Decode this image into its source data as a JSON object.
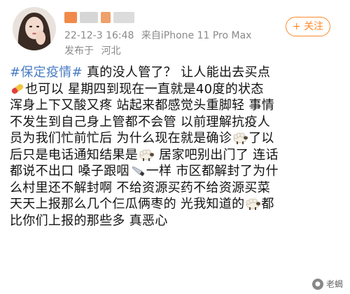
{
  "header": {
    "avatar_alt": "user avatar",
    "timestamp": "22-12-3 16:48",
    "source": "来自iPhone 11 Pro Max",
    "location_prefix": "发布于",
    "location": "河北",
    "follow_label": "+ 关注"
  },
  "post": {
    "hashtag": "#保定疫情#",
    "lines": [
      {
        "before_emoji": " 真的没人管了？ 让人能出去买点",
        "after_emoji": ""
      },
      {
        "before_emoji": "",
        "after_emoji": "也可以 星期四到现在一直就是40度的状态"
      },
      {
        "before_emoji": "浑身上下又酸又疼 站起来都感觉头重脚轻 事情",
        "after_emoji": ""
      },
      {
        "before_emoji": "不发生到自己身上管都不会管 以前理解抗疫人",
        "after_emoji": ""
      },
      {
        "before_emoji": "员为我们忙前忙后 为什么现在就是确诊",
        "after_emoji": "了以"
      },
      {
        "before_emoji": "后只是电话通知结果是",
        "after_emoji": " 居家吧别出门了 连话"
      },
      {
        "before_emoji": "都说不出口 嗓子跟咽",
        "after_emoji": "一样 市区都解封了为什"
      },
      {
        "before_emoji": "么村里还不解封啊 不给资源买药不给资源买菜",
        "after_emoji": ""
      },
      {
        "before_emoji": "天天上报那么几个仨瓜俩枣的 光我知道的",
        "after_emoji": "都"
      },
      {
        "before_emoji": "比你们上报的那些多 真恶心",
        "after_emoji": ""
      }
    ],
    "emojis": {
      "pill": "pill-icon",
      "sheep": "sheep-icon",
      "knife": "knife-icon"
    }
  },
  "watermark": {
    "text": "老蝎"
  },
  "colors": {
    "hashtag": "#4a7cc2",
    "follow": "#ff8a2a",
    "meta": "#8a8a8a"
  }
}
